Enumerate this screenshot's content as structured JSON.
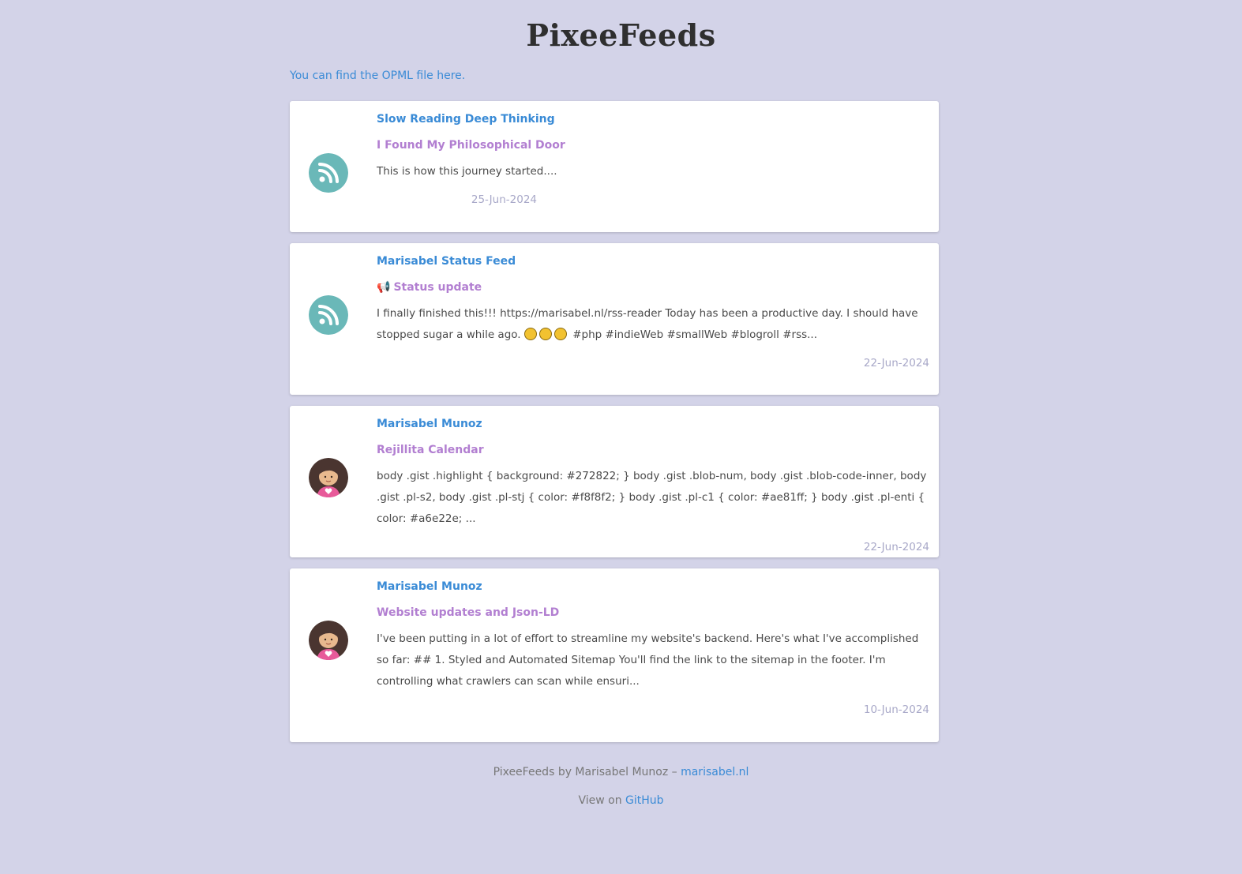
{
  "site": {
    "title": "PixeeFeeds",
    "opml_prefix": "You can find the OPML file ",
    "opml_link": "here",
    "opml_suffix": "."
  },
  "colors": {
    "background": "#d3d3e8",
    "feed_name": "#3a8bd6",
    "item_title": "#b27fd1",
    "date": "#a8a8c8",
    "rss_icon_bg": "#6ab8b8"
  },
  "feed_items": [
    {
      "icon": "rss-icon",
      "feed_name": "Slow Reading Deep Thinking",
      "title_prefix": "",
      "title": "I Found My Philosophical Door",
      "excerpt": "This is how this journey started....",
      "date": "25-Jun-2024"
    },
    {
      "icon": "rss-icon",
      "feed_name": "Marisabel Status Feed",
      "title_prefix": "📢",
      "title": "Status update",
      "excerpt_before": "I finally finished this!!! https://marisabel.nl/rss-reader Today has been a productive day. I should have stopped sugar a while ago.",
      "excerpt_after": "#php #indieWeb #smallWeb #blogroll #rss...",
      "date": "22-Jun-2024"
    },
    {
      "icon": "avatar-girl-icon",
      "feed_name": "Marisabel Munoz",
      "title_prefix": "",
      "title": "Rejillita Calendar",
      "excerpt": "body .gist .highlight { background: #272822; } body .gist .blob-num, body .gist .blob-code-inner, body .gist .pl-s2, body .gist .pl-stj { color: #f8f8f2; } body .gist .pl-c1 { color: #ae81ff; } body .gist .pl-enti { color: #a6e22e; ...",
      "date": "22-Jun-2024"
    },
    {
      "icon": "avatar-girl-icon",
      "feed_name": "Marisabel Munoz",
      "title_prefix": "",
      "title": "Website updates and Json-LD",
      "excerpt": "I've been putting in a lot of effort to streamline my website's backend. Here's what I've accomplished so far: ## 1. Styled and Automated Sitemap You'll find the link to the sitemap in the footer. I'm controlling what crawlers can scan while ensuri...",
      "date": "10-Jun-2024"
    }
  ],
  "footer": {
    "credit": "PixeeFeeds by Marisabel Munoz – ",
    "site_link": "marisabel.nl",
    "view_on": "View on ",
    "github_link": "GitHub"
  }
}
